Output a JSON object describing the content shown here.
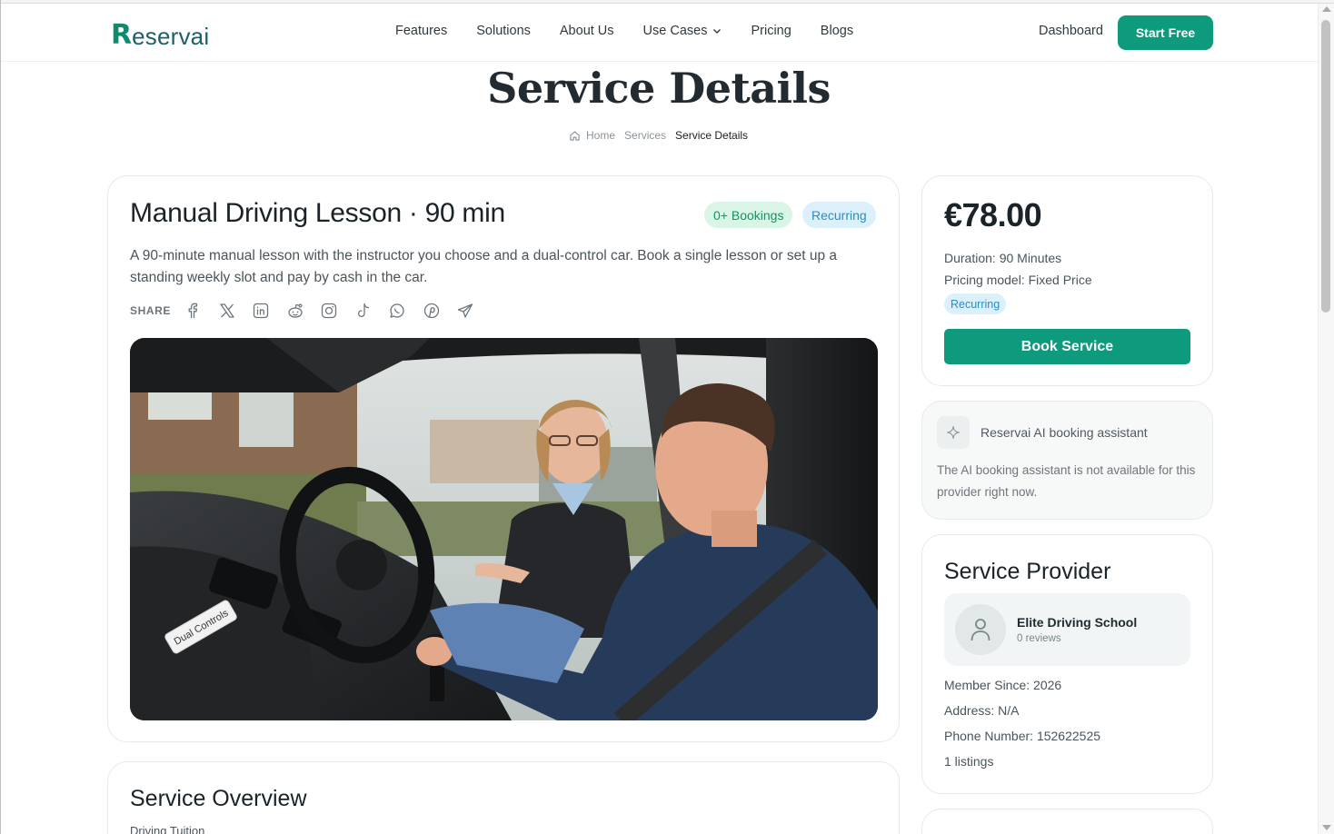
{
  "brand": {
    "logo_mark": "R",
    "logo_text": "eservai",
    "accent": "#0e9a7c"
  },
  "nav": {
    "links": [
      "Features",
      "Solutions",
      "About Us",
      "Use Cases",
      "Pricing",
      "Blogs"
    ],
    "dashboard": "Dashboard",
    "cta": "Start Free"
  },
  "hero": {
    "title": "Service Details",
    "breadcrumb": [
      "Home",
      "Services",
      "Service Details"
    ]
  },
  "service": {
    "title": "Manual Driving Lesson · 90 min",
    "bookings_badge": "0+ Bookings",
    "recurring_badge": "Recurring",
    "description": "A 90-minute manual lesson with the instructor you choose and a dual-control car. Book a single lesson or set up a standing weekly slot and pay by cash in the car.",
    "share_label": "SHARE",
    "share_icons": [
      "facebook-icon",
      "x-icon",
      "linkedin-icon",
      "reddit-icon",
      "instagram-icon",
      "tiktok-icon",
      "whatsapp-icon",
      "pinterest-icon",
      "telegram-icon"
    ],
    "photo_sticker": "Dual Controls"
  },
  "overview": {
    "title": "Service Overview",
    "subtitle": "Driving Tuition"
  },
  "pricing": {
    "price": "€78.00",
    "duration": "Duration: 90 Minutes",
    "model": "Pricing model: Fixed Price",
    "badge": "Recurring",
    "book_button": "Book Service"
  },
  "ai_assistant": {
    "title": "Reservai AI booking assistant",
    "message": "The AI booking assistant is not available for this provider right now."
  },
  "provider": {
    "section_title": "Service Provider",
    "name": "Elite Driving School",
    "reviews": "0 reviews",
    "member_since": "Member Since: 2026",
    "address": "Address: N/A",
    "phone": "Phone Number: 152622525",
    "listings": "1 listings"
  }
}
